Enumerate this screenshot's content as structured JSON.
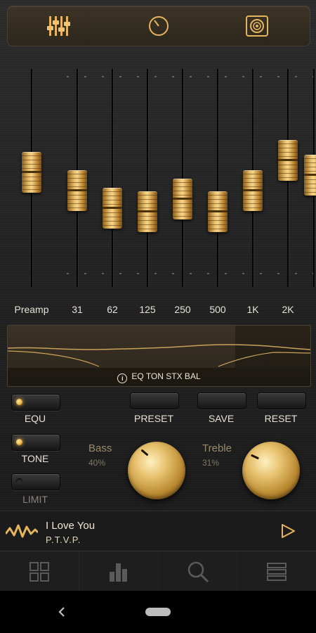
{
  "top_tabs": [
    {
      "name": "equalizer-icon"
    },
    {
      "name": "knob-icon"
    },
    {
      "name": "speaker-icon"
    }
  ],
  "eq": {
    "bands": [
      {
        "label": "Preamp",
        "level": 0.53
      },
      {
        "label": "31",
        "level": 0.43
      },
      {
        "label": "62",
        "level": 0.33
      },
      {
        "label": "125",
        "level": 0.31
      },
      {
        "label": "250",
        "level": 0.38
      },
      {
        "label": "500",
        "level": 0.31
      },
      {
        "label": "1K",
        "level": 0.43
      },
      {
        "label": "2K",
        "level": 0.6
      }
    ]
  },
  "curve_panel": {
    "info_text": "EQ TON STX BAL"
  },
  "controls": {
    "equ": {
      "label": "EQU",
      "on": true
    },
    "tone": {
      "label": "TONE",
      "on": true
    },
    "limit": {
      "label": "LIMIT",
      "on": false
    },
    "preset_label": "PRESET",
    "save_label": "SAVE",
    "reset_label": "RESET",
    "bass": {
      "title": "Bass",
      "value": "40%"
    },
    "treble": {
      "title": "Treble",
      "value": "31%"
    }
  },
  "player": {
    "title": "I Love You",
    "artist": "P.T.V.P."
  },
  "bottom_tabs": [
    {
      "name": "grid-icon"
    },
    {
      "name": "bar-chart-icon"
    },
    {
      "name": "search-icon"
    },
    {
      "name": "list-icon"
    }
  ],
  "colors": {
    "gold": "#e0b35a",
    "panel": "#2f281f"
  }
}
